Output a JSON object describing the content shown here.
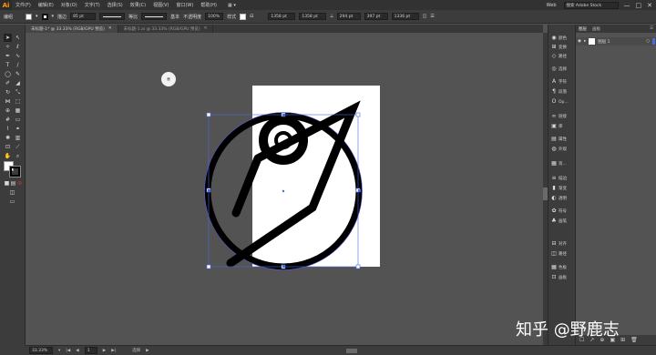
{
  "menubar": {
    "logo": "Ai",
    "items": [
      "文件(F)",
      "编辑(E)",
      "对象(O)",
      "文字(T)",
      "选择(S)",
      "效果(C)",
      "视图(V)",
      "窗口(W)",
      "帮助(H)"
    ],
    "workspace": "Web",
    "search_placeholder": "搜索 Adobe Stock",
    "window_controls": [
      "—",
      "□",
      "✕"
    ]
  },
  "controlbar": {
    "label": "编组",
    "stroke_label": "描边",
    "stroke_value": "85 pt",
    "stroke_style_1": "等比",
    "stroke_style_2": "基本",
    "opacity_label": "不透明度",
    "opacity_value": "100%",
    "style_label": "样式",
    "x_value": "1358 pt",
    "y_value": "1358 pt",
    "w_value": "294 pt",
    "h_value": "397 pt",
    "coord_value": "1336 pt"
  },
  "tabs": [
    {
      "label": "未标题-1* @ 33.33% (RGB/GPU 预览)",
      "close": "✕"
    },
    {
      "label": "未标题-1.ai @ 33.33% (RGB/GPU 预览)",
      "close": "✕"
    }
  ],
  "statusbar": {
    "zoom": "33.33%",
    "artboard_num": "1",
    "tool_name": "选择"
  },
  "dock": {
    "items": [
      {
        "label": "颜色",
        "icon": "color-icon"
      },
      {
        "label": "变换",
        "icon": "transform-icon"
      },
      {
        "label": "路径",
        "icon": "path-icon"
      },
      {
        "label": "选择",
        "icon": "select-icon"
      },
      {
        "label": "字符",
        "icon": "character-icon"
      },
      {
        "label": "段落",
        "icon": "paragraph-icon"
      },
      {
        "label": "Op...",
        "icon": "opentype-icon"
      },
      {
        "label": "链接",
        "icon": "links-icon"
      },
      {
        "label": "库",
        "icon": "libraries-icon"
      },
      {
        "label": "属性",
        "icon": "properties-icon"
      },
      {
        "label": "外观",
        "icon": "appearance-icon"
      },
      {
        "label": "资...",
        "icon": "assets-icon"
      },
      {
        "label": "描边",
        "icon": "stroke-icon"
      },
      {
        "label": "渐变",
        "icon": "gradient-icon"
      },
      {
        "label": "透明",
        "icon": "transparency-icon"
      },
      {
        "label": "符号",
        "icon": "symbols-icon"
      },
      {
        "label": "画笔",
        "icon": "brushes-icon"
      },
      {
        "label": "对齐",
        "icon": "align-icon"
      },
      {
        "label": "路径",
        "icon": "pathfinder-icon"
      },
      {
        "label": "色板",
        "icon": "swatches-icon"
      },
      {
        "label": "画板",
        "icon": "artboards-icon"
      }
    ]
  },
  "layers_panel": {
    "tabs": [
      "图层",
      "画板"
    ],
    "layer_name": "图层 1",
    "footer_glyphs": [
      "☐",
      "↗",
      "⊕",
      "▣",
      "⊞",
      "🗑"
    ]
  },
  "badge": {
    "text": "鹿"
  },
  "watermark": "知乎 @野鹿志"
}
